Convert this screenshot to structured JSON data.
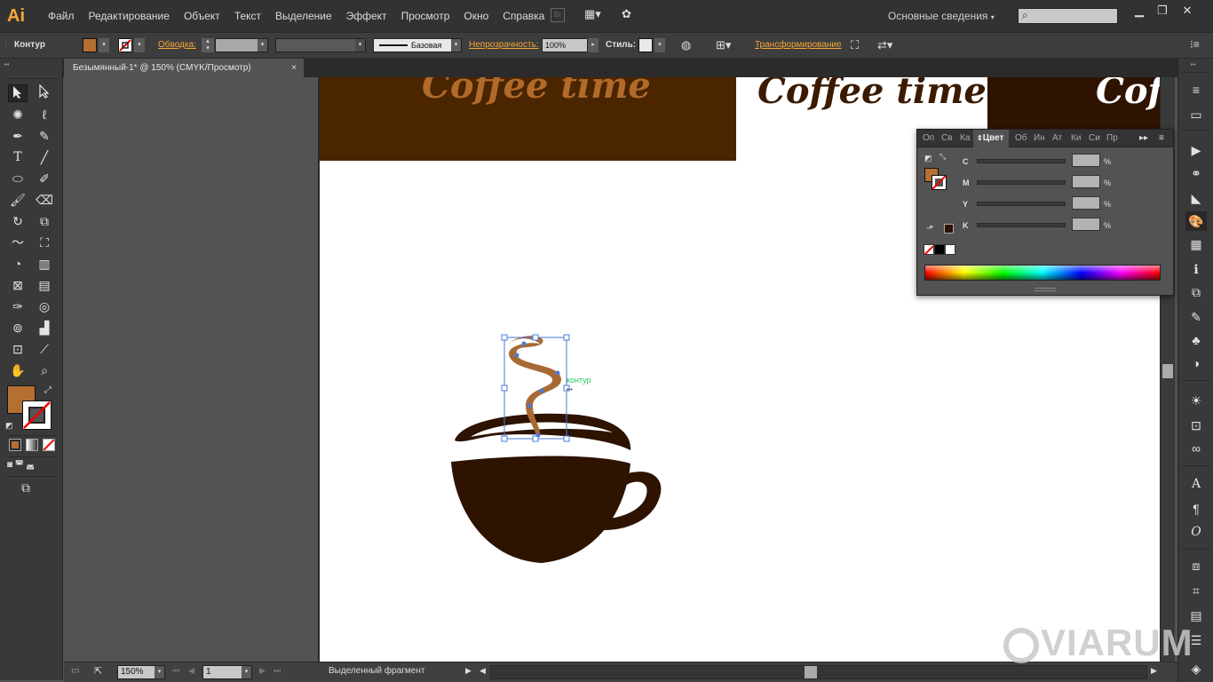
{
  "app": {
    "logo": "Ai",
    "menu": [
      "Файл",
      "Редактирование",
      "Объект",
      "Текст",
      "Выделение",
      "Эффект",
      "Просмотр",
      "Окно",
      "Справка"
    ],
    "workspace": "Основные сведения",
    "colors": {
      "accent": "#f7a735",
      "menubar": "#323232",
      "panel": "#535353",
      "selection": "#4a79d8"
    }
  },
  "control_bar": {
    "object_type": "Контур",
    "fill_color": "#b56f33",
    "stroke_link": "Обводка:",
    "stroke_style": "Базовая",
    "opacity_link": "Непрозрачность:",
    "opacity_value": "100%",
    "style_label": "Стиль:",
    "transform_link": "Трансформирование"
  },
  "document": {
    "tab_title": "Безымянный-1* @ 150% (CMYK/Просмотр)",
    "close": "×"
  },
  "artwork": {
    "banner_texts": [
      "Coffee time",
      "Coffee time",
      "Coffee time"
    ],
    "banner_colors": [
      "#4b2400",
      "#ffffff",
      "#2d1300"
    ],
    "banner_text_colors": [
      "#b06a2a",
      "#3b1a00",
      "#ffffff"
    ],
    "cup_color": "#2d1300",
    "steam_color": "#a86a35",
    "hover_label": "контур"
  },
  "status_bar": {
    "zoom": "150%",
    "artboard_number": "1",
    "status_text": "Выделенный фрагмент"
  },
  "color_panel": {
    "tabs": [
      "Оп",
      "Св",
      "Ка",
      "Цвет",
      "Об",
      "Ин",
      "Ат",
      "Ки",
      "Си",
      "Пр"
    ],
    "active_tab": "Цвет",
    "channels": [
      {
        "label": "C",
        "unit": "%"
      },
      {
        "label": "M",
        "unit": "%"
      },
      {
        "label": "Y",
        "unit": "%"
      },
      {
        "label": "K",
        "unit": "%"
      }
    ]
  },
  "watermark": "VIARUM"
}
